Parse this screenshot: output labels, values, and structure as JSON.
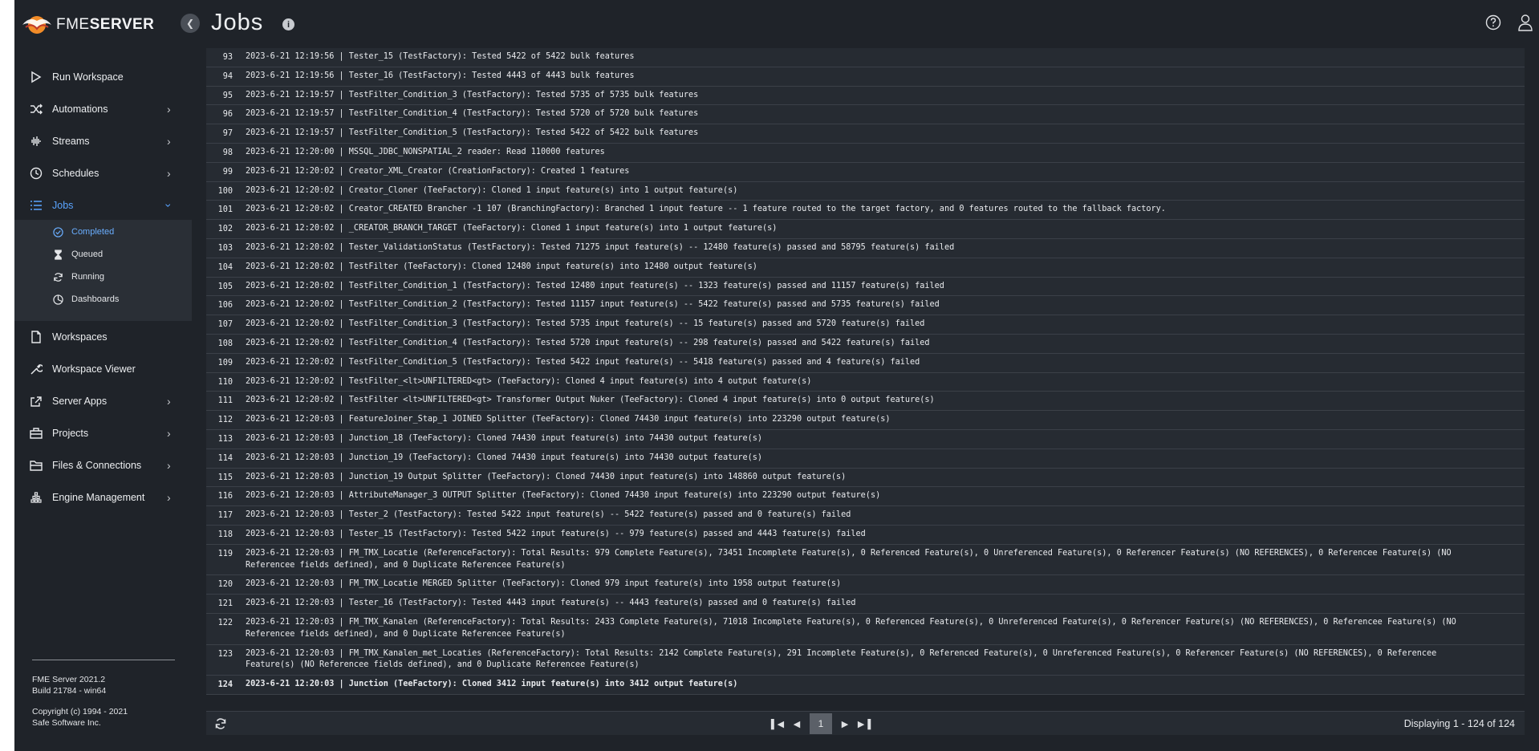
{
  "header": {
    "brand_light": "FME",
    "brand_bold": "SERVER",
    "title": "Jobs",
    "info_glyph": "i"
  },
  "colors": {
    "accent": "#5aa4ff",
    "background": "#1f2329",
    "row": "#262b32"
  },
  "sidebar": {
    "items": [
      {
        "label": "Run Workspace",
        "icon": "play-icon",
        "chevron": false
      },
      {
        "label": "Automations",
        "icon": "shuffle-icon",
        "chevron": true
      },
      {
        "label": "Streams",
        "icon": "waveform-icon",
        "chevron": true
      },
      {
        "label": "Schedules",
        "icon": "clock-icon",
        "chevron": true
      },
      {
        "label": "Jobs",
        "icon": "list-icon",
        "chevron": true,
        "expanded": true
      },
      {
        "label": "Workspaces",
        "icon": "document-icon",
        "chevron": false
      },
      {
        "label": "Workspace Viewer",
        "icon": "wrench-icon",
        "chevron": false
      },
      {
        "label": "Server Apps",
        "icon": "share-icon",
        "chevron": true
      },
      {
        "label": "Projects",
        "icon": "briefcase-icon",
        "chevron": true
      },
      {
        "label": "Files & Connections",
        "icon": "folder-icon",
        "chevron": true
      },
      {
        "label": "Engine Management",
        "icon": "engine-icon",
        "chevron": true
      }
    ],
    "jobs_sub": [
      {
        "label": "Completed",
        "icon": "check-circle-icon",
        "active": true
      },
      {
        "label": "Queued",
        "icon": "hourglass-icon"
      },
      {
        "label": "Running",
        "icon": "refresh-icon"
      },
      {
        "label": "Dashboards",
        "icon": "pie-chart-icon"
      }
    ],
    "version_line1": "FME Server 2021.2",
    "version_line2": "Build 21784 - win64",
    "copyright_line1": "Copyright (c) 1994 - 2021",
    "copyright_line2": "Safe Software Inc."
  },
  "log": [
    {
      "n": "93",
      "t": "2023-6-21 12:19:56 | Tester_15 (TestFactory): Tested 5422 of 5422 bulk features"
    },
    {
      "n": "94",
      "t": "2023-6-21 12:19:56 | Tester_16 (TestFactory): Tested 4443 of 4443 bulk features"
    },
    {
      "n": "95",
      "t": "2023-6-21 12:19:57 | TestFilter_Condition_3 (TestFactory): Tested 5735 of 5735 bulk features"
    },
    {
      "n": "96",
      "t": "2023-6-21 12:19:57 | TestFilter_Condition_4 (TestFactory): Tested 5720 of 5720 bulk features"
    },
    {
      "n": "97",
      "t": "2023-6-21 12:19:57 | TestFilter_Condition_5 (TestFactory): Tested 5422 of 5422 bulk features"
    },
    {
      "n": "98",
      "t": "2023-6-21 12:20:00 | MSSQL_JDBC_NONSPATIAL_2 reader: Read 110000 features"
    },
    {
      "n": "99",
      "t": "2023-6-21 12:20:02 | Creator_XML_Creator (CreationFactory): Created 1 features"
    },
    {
      "n": "100",
      "t": "2023-6-21 12:20:02 | Creator_Cloner (TeeFactory): Cloned 1 input feature(s) into 1 output feature(s)"
    },
    {
      "n": "101",
      "t": "2023-6-21 12:20:02 | Creator_CREATED Brancher -1 107 (BranchingFactory): Branched 1 input feature -- 1 feature routed to the target factory, and 0 features routed to the fallback factory."
    },
    {
      "n": "102",
      "t": "2023-6-21 12:20:02 | _CREATOR_BRANCH_TARGET (TeeFactory): Cloned 1 input feature(s) into 1 output feature(s)"
    },
    {
      "n": "103",
      "t": "2023-6-21 12:20:02 | Tester_ValidationStatus (TestFactory): Tested 71275 input feature(s) -- 12480 feature(s) passed and 58795 feature(s) failed"
    },
    {
      "n": "104",
      "t": "2023-6-21 12:20:02 | TestFilter (TeeFactory): Cloned 12480 input feature(s) into 12480 output feature(s)"
    },
    {
      "n": "105",
      "t": "2023-6-21 12:20:02 | TestFilter_Condition_1 (TestFactory): Tested 12480 input feature(s) -- 1323 feature(s) passed and 11157 feature(s) failed"
    },
    {
      "n": "106",
      "t": "2023-6-21 12:20:02 | TestFilter_Condition_2 (TestFactory): Tested 11157 input feature(s) -- 5422 feature(s) passed and 5735 feature(s) failed"
    },
    {
      "n": "107",
      "t": "2023-6-21 12:20:02 | TestFilter_Condition_3 (TestFactory): Tested 5735 input feature(s) -- 15 feature(s) passed and 5720 feature(s) failed"
    },
    {
      "n": "108",
      "t": "2023-6-21 12:20:02 | TestFilter_Condition_4 (TestFactory): Tested 5720 input feature(s) -- 298 feature(s) passed and 5422 feature(s) failed"
    },
    {
      "n": "109",
      "t": "2023-6-21 12:20:02 | TestFilter_Condition_5 (TestFactory): Tested 5422 input feature(s) -- 5418 feature(s) passed and 4 feature(s) failed"
    },
    {
      "n": "110",
      "t": "2023-6-21 12:20:02 | TestFilter_<lt>UNFILTERED<gt> (TeeFactory): Cloned 4 input feature(s) into 4 output feature(s)"
    },
    {
      "n": "111",
      "t": "2023-6-21 12:20:02 | TestFilter <lt>UNFILTERED<gt> Transformer Output Nuker (TeeFactory): Cloned 4 input feature(s) into 0 output feature(s)"
    },
    {
      "n": "112",
      "t": "2023-6-21 12:20:03 | FeatureJoiner_Stap_1 JOINED Splitter (TeeFactory): Cloned 74430 input feature(s) into 223290 output feature(s)"
    },
    {
      "n": "113",
      "t": "2023-6-21 12:20:03 | Junction_18 (TeeFactory): Cloned 74430 input feature(s) into 74430 output feature(s)"
    },
    {
      "n": "114",
      "t": "2023-6-21 12:20:03 | Junction_19 (TeeFactory): Cloned 74430 input feature(s) into 74430 output feature(s)"
    },
    {
      "n": "115",
      "t": "2023-6-21 12:20:03 | Junction_19 Output Splitter (TeeFactory): Cloned 74430 input feature(s) into 148860 output feature(s)"
    },
    {
      "n": "116",
      "t": "2023-6-21 12:20:03 | AttributeManager_3 OUTPUT Splitter (TeeFactory): Cloned 74430 input feature(s) into 223290 output feature(s)"
    },
    {
      "n": "117",
      "t": "2023-6-21 12:20:03 | Tester_2 (TestFactory): Tested 5422 input feature(s) -- 5422 feature(s) passed and 0 feature(s) failed"
    },
    {
      "n": "118",
      "t": "2023-6-21 12:20:03 | Tester_15 (TestFactory): Tested 5422 input feature(s) -- 979 feature(s) passed and 4443 feature(s) failed"
    },
    {
      "n": "119",
      "t": "2023-6-21 12:20:03 | FM_TMX_Locatie (ReferenceFactory): Total Results: 979 Complete Feature(s), 73451 Incomplete Feature(s), 0 Referenced Feature(s), 0 Unreferenced Feature(s), 0 Referencer Feature(s) (NO REFERENCES), 0 Referencee Feature(s) (NO Referencee fields defined), and 0 Duplicate Referencee Feature(s)"
    },
    {
      "n": "120",
      "t": "2023-6-21 12:20:03 | FM_TMX_Locatie MERGED Splitter (TeeFactory): Cloned 979 input feature(s) into 1958 output feature(s)"
    },
    {
      "n": "121",
      "t": "2023-6-21 12:20:03 | Tester_16 (TestFactory): Tested 4443 input feature(s) -- 4443 feature(s) passed and 0 feature(s) failed"
    },
    {
      "n": "122",
      "t": "2023-6-21 12:20:03 | FM_TMX_Kanalen (ReferenceFactory): Total Results: 2433 Complete Feature(s), 71018 Incomplete Feature(s), 0 Referenced Feature(s), 0 Unreferenced Feature(s), 0 Referencer Feature(s) (NO REFERENCES), 0 Referencee Feature(s) (NO Referencee fields defined), and 0 Duplicate Referencee Feature(s)"
    },
    {
      "n": "123",
      "t": "2023-6-21 12:20:03 | FM_TMX_Kanalen_met_Locaties (ReferenceFactory): Total Results: 2142 Complete Feature(s), 291 Incomplete Feature(s), 0 Referenced Feature(s), 0 Unreferenced Feature(s), 0 Referencer Feature(s) (NO REFERENCES), 0 Referencee Feature(s) (NO Referencee fields defined), and 0 Duplicate Referencee Feature(s)"
    },
    {
      "n": "124",
      "t": "2023-6-21 12:20:03 | Junction (TeeFactory): Cloned 3412 input feature(s) into 3412 output feature(s)",
      "bold": true
    }
  ],
  "footer": {
    "current_page": "1",
    "display_count": "Displaying 1 - 124 of 124"
  }
}
